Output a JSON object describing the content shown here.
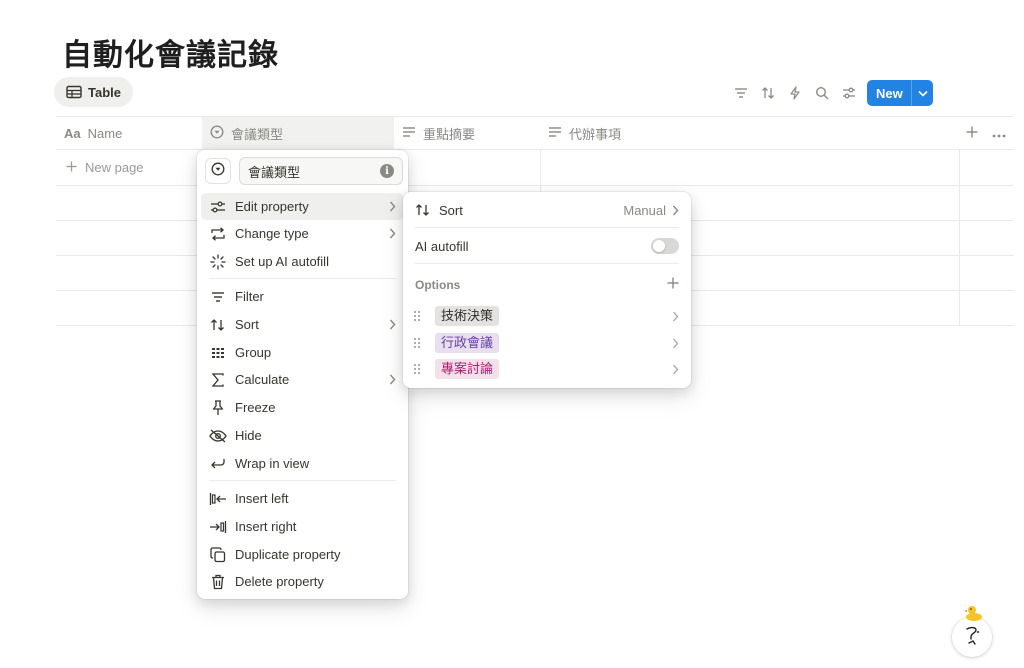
{
  "page": {
    "title": "自動化會議記錄"
  },
  "view": {
    "tab_label": "Table"
  },
  "toolbar": {
    "icons": [
      "filter-icon",
      "sort-icon",
      "automation-icon",
      "search-icon",
      "settings-icon"
    ],
    "new_label": "New",
    "accent": "#2383e2"
  },
  "table": {
    "columns": [
      {
        "icon": "text-icon",
        "label": "Name",
        "icon_glyph": "Aa"
      },
      {
        "icon": "select-icon",
        "label": "會議類型"
      },
      {
        "icon": "text-lines-icon",
        "label": "重點摘要"
      },
      {
        "icon": "text-lines-icon",
        "label": "代辦事項"
      }
    ],
    "new_page_label": "New page"
  },
  "property_menu": {
    "name_value": "會議類型",
    "info_glyph": "i",
    "items": [
      {
        "id": "edit",
        "label": "Edit property",
        "icon": "sliders-icon",
        "submenu": true
      },
      {
        "id": "change-type",
        "label": "Change type",
        "icon": "swap-icon",
        "submenu": true
      },
      {
        "id": "ai",
        "label": "Set up AI autofill",
        "icon": "sparkle-icon",
        "submenu": false
      },
      {
        "id": "filter",
        "label": "Filter",
        "icon": "filter-icon",
        "submenu": false
      },
      {
        "id": "sort",
        "label": "Sort",
        "icon": "sort-icon",
        "submenu": true
      },
      {
        "id": "group",
        "label": "Group",
        "icon": "group-icon",
        "submenu": false
      },
      {
        "id": "calculate",
        "label": "Calculate",
        "icon": "sigma-icon",
        "submenu": true
      },
      {
        "id": "freeze",
        "label": "Freeze",
        "icon": "pin-icon",
        "submenu": false
      },
      {
        "id": "hide",
        "label": "Hide",
        "icon": "eye-off-icon",
        "submenu": false
      },
      {
        "id": "wrap",
        "label": "Wrap in view",
        "icon": "wrap-icon",
        "submenu": false
      },
      {
        "id": "insert-left",
        "label": "Insert left",
        "icon": "insert-left-icon",
        "submenu": false
      },
      {
        "id": "insert-right",
        "label": "Insert right",
        "icon": "insert-right-icon",
        "submenu": false
      },
      {
        "id": "duplicate",
        "label": "Duplicate property",
        "icon": "duplicate-icon",
        "submenu": false
      },
      {
        "id": "delete",
        "label": "Delete property",
        "icon": "trash-icon",
        "submenu": false
      }
    ]
  },
  "edit_submenu": {
    "sort_label": "Sort",
    "sort_value": "Manual",
    "ai_autofill_label": "AI autofill",
    "ai_autofill_on": false,
    "options_label": "Options",
    "options": [
      {
        "label": "技術決策",
        "bg": "#e3e2e0",
        "fg": "#32302c"
      },
      {
        "label": "行政會議",
        "bg": "#e8deee",
        "fg": "#6940a5"
      },
      {
        "label": "專案討論",
        "bg": "#f5e0e9",
        "fg": "#ad1a72"
      }
    ]
  }
}
